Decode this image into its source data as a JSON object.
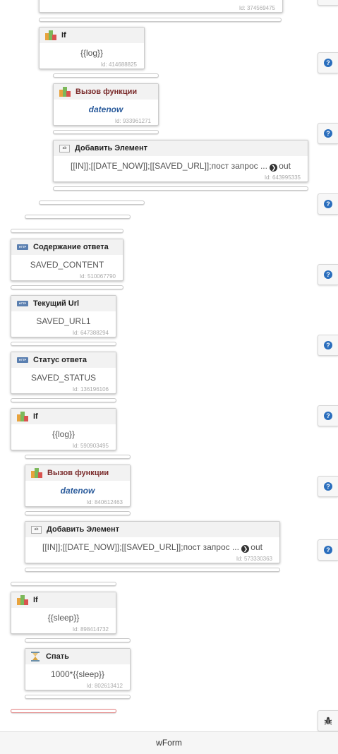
{
  "blocks": {
    "top": {
      "id": "Id: 374569475"
    },
    "if1": {
      "title": "If",
      "body": "{{log}}",
      "id": "Id: 414688825",
      "icon": "if-icon"
    },
    "func1": {
      "title": "Вызов функции",
      "body": "datenow",
      "id": "Id: 933961271",
      "icon": "function-icon"
    },
    "add1": {
      "title": "Добавить Элемент",
      "body": "[[IN]];[[DATE_NOW]];[[SAVED_URL]];пост запрос ...",
      "out": "out",
      "id": "Id: 643995335",
      "icon": "add-element-icon"
    },
    "content": {
      "title": "Содержание ответа",
      "body": "SAVED_CONTENT",
      "id": "Id: 510067790",
      "icon": "http-icon"
    },
    "url": {
      "title": "Текущий Url",
      "body": "SAVED_URL1",
      "id": "Id: 647388294",
      "icon": "http-icon"
    },
    "status": {
      "title": "Статус ответа",
      "body": "SAVED_STATUS",
      "id": "Id: 136196106",
      "icon": "http-icon"
    },
    "if2": {
      "title": "If",
      "body": "{{log}}",
      "id": "Id: 590903495",
      "icon": "if-icon"
    },
    "func2": {
      "title": "Вызов функции",
      "body": "datenow",
      "id": "Id: 840612463",
      "icon": "function-icon"
    },
    "add2": {
      "title": "Добавить Элемент",
      "body": "[[IN]];[[DATE_NOW]];[[SAVED_URL]];пост запрос ...",
      "out": "out",
      "id": "Id: 573330363",
      "icon": "add-element-icon"
    },
    "if3": {
      "title": "If",
      "body": "{{sleep}}",
      "id": "Id: 898414732",
      "icon": "if-icon"
    },
    "sleep": {
      "title": "Спать",
      "body": "1000*{{sleep}}",
      "id": "Id: 802613412",
      "icon": "hourglass-icon"
    }
  },
  "help_buttons": {
    "label": "?",
    "icon": "help-icon"
  },
  "debug_button": {
    "icon": "bug-icon"
  },
  "footer": {
    "title": "wForm"
  },
  "colors": {
    "help_blue": "#2a6ebd",
    "function_title": "#7a2b2b",
    "function_body": "#2c5c9c",
    "bar_error": "#e07a7a"
  }
}
